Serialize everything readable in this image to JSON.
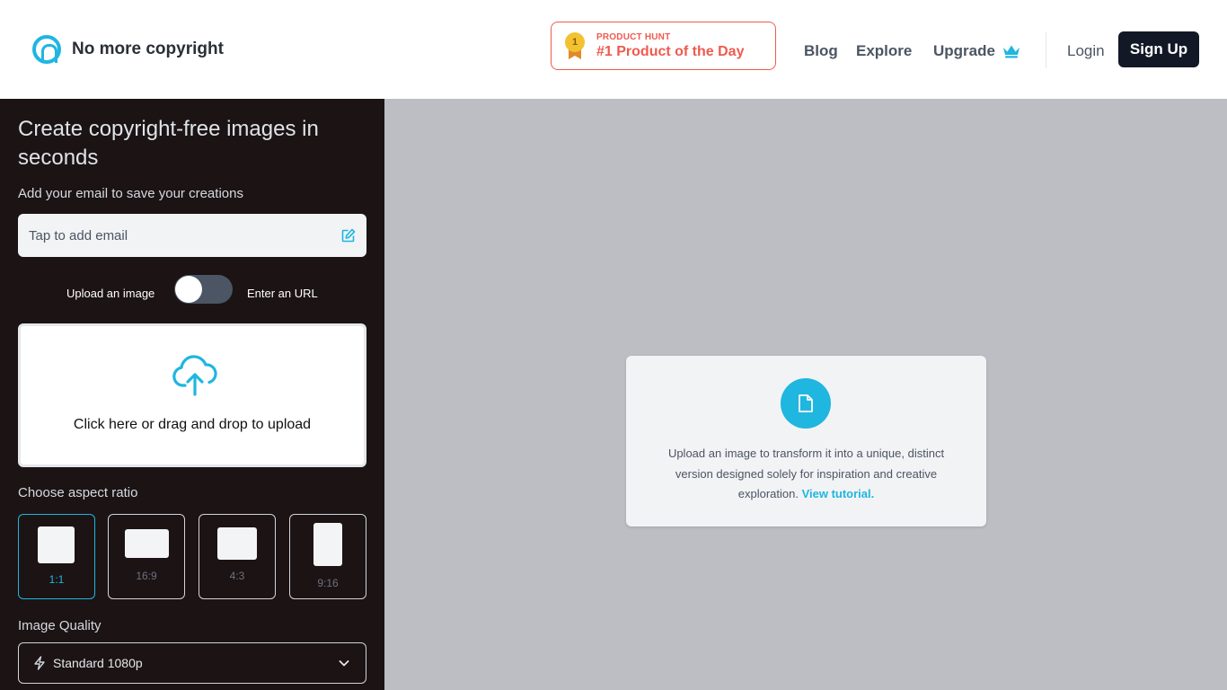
{
  "header": {
    "brand": "No more copyright",
    "product_hunt": {
      "small": "PRODUCT HUNT",
      "big": "#1 Product of the Day",
      "rank": "1"
    },
    "nav": {
      "blog": "Blog",
      "explore": "Explore",
      "upgrade": "Upgrade",
      "login": "Login",
      "signup": "Sign Up"
    }
  },
  "sidebar": {
    "title": "Create copyright-free images in seconds",
    "email_hint": "Add your email to save your creations",
    "email_placeholder": "Tap to add email",
    "toggle": {
      "left": "Upload an image",
      "right": "Enter an URL"
    },
    "upload_text": "Click here or drag and drop to upload",
    "aspect_ratio_label": "Choose aspect ratio",
    "aspect_ratios": [
      "1:1",
      "16:9",
      "4:3",
      "9:16"
    ],
    "selected_aspect_ratio": "1:1",
    "image_quality_label": "Image Quality",
    "image_quality_value": "Standard 1080p"
  },
  "main": {
    "card_text": "Upload an image to transform it into a unique, distinct version designed solely for inspiration and creative exploration.",
    "card_link": "View tutorial."
  },
  "colors": {
    "accent": "#1fb6e0",
    "sidebar_bg": "#1b1314",
    "main_bg": "#bdbec3",
    "product_hunt": "#ef5a4e",
    "signup_bg": "#121826"
  },
  "icons": [
    "logo-icon",
    "medal-icon",
    "crown-icon",
    "edit-icon",
    "cloud-upload-icon",
    "bolt-icon",
    "chevron-down-icon",
    "file-icon"
  ]
}
